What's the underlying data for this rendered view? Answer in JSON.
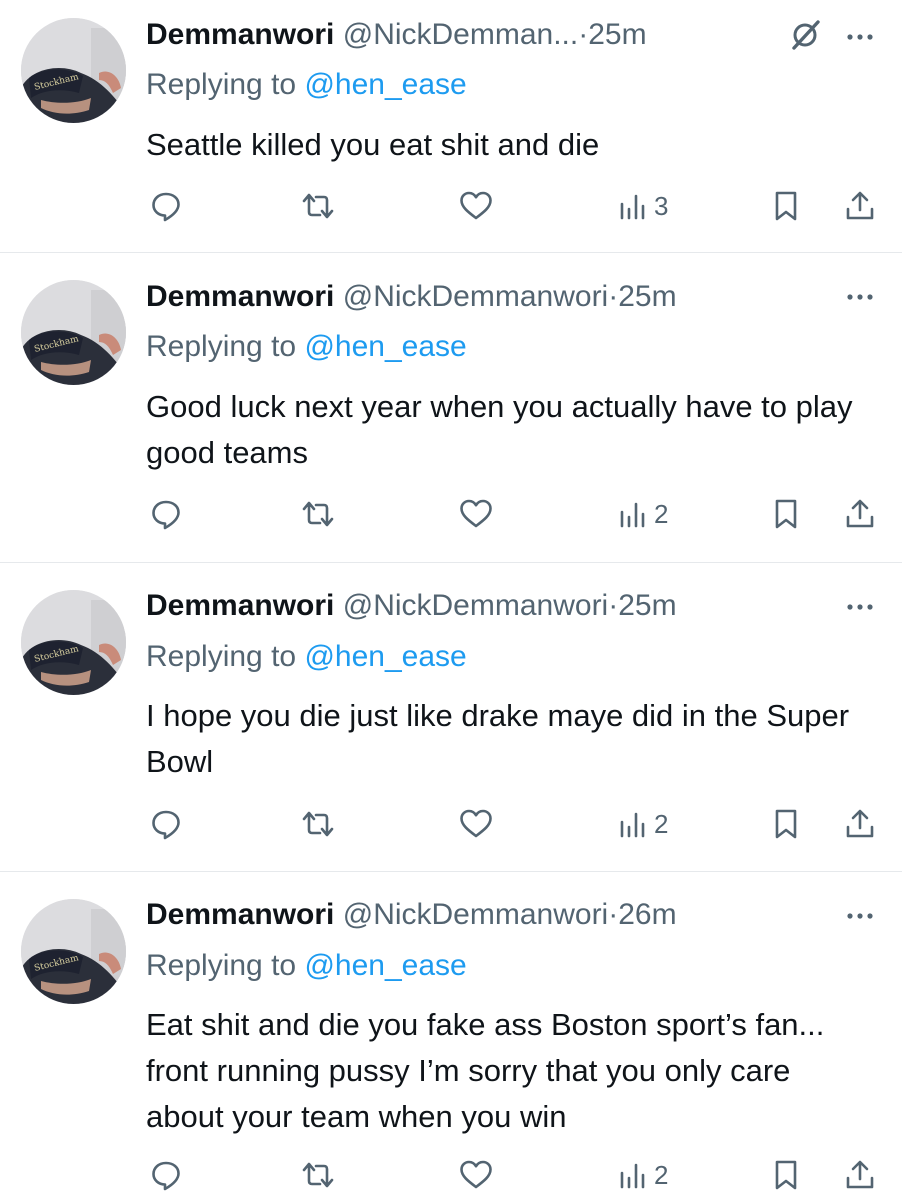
{
  "colors": {
    "text": "#0f1419",
    "secondary": "#536471",
    "link": "#1d9bf0",
    "divider": "#e6e9ec"
  },
  "icons": [
    "grok-icon",
    "more-icon",
    "reply-icon",
    "retweet-icon",
    "like-icon",
    "views-icon",
    "bookmark-icon",
    "share-icon"
  ],
  "tweets": [
    {
      "name": "Demmanwori",
      "handle": "@NickDemman...",
      "dot": "·",
      "time": "25m",
      "reply_prefix": "Replying to",
      "reply_to": "@hen_ease",
      "text": "Seattle killed you eat shit and die",
      "views": "3"
    },
    {
      "name": "Demmanwori",
      "handle": "@NickDemmanwori",
      "dot": "·",
      "time": "25m",
      "reply_prefix": "Replying to",
      "reply_to": "@hen_ease",
      "text": "Good luck next year when you actually have to play good teams",
      "views": "2"
    },
    {
      "name": "Demmanwori",
      "handle": "@NickDemmanwori",
      "dot": "·",
      "time": "25m",
      "reply_prefix": "Replying to",
      "reply_to": "@hen_ease",
      "text": "I hope you die just like drake maye did in the Super Bowl",
      "views": "2"
    },
    {
      "name": "Demmanwori",
      "handle": "@NickDemmanwori",
      "dot": "·",
      "time": "26m",
      "reply_prefix": "Replying to",
      "reply_to": "@hen_ease",
      "text": "Eat shit and die you fake ass Boston sport’s fan... front running pussy I’m sorry that you only care about your team when you win",
      "views": "2"
    }
  ]
}
